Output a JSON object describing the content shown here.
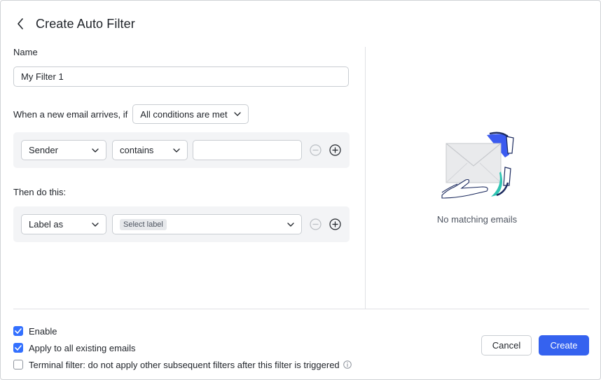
{
  "dialog": {
    "title": "Create Auto Filter"
  },
  "name_section": {
    "label": "Name",
    "value": "My Filter 1"
  },
  "conditions": {
    "prefix": "When a new email arrives, if",
    "match_mode": "All conditions are met",
    "rule": {
      "field": "Sender",
      "operator": "contains",
      "value": ""
    }
  },
  "actions": {
    "label": "Then do this:",
    "rule": {
      "action": "Label as",
      "target_placeholder": "Select label"
    }
  },
  "preview": {
    "empty_text": "No matching emails"
  },
  "options": [
    {
      "label": "Enable",
      "checked": true
    },
    {
      "label": "Apply to all existing emails",
      "checked": true
    },
    {
      "label": "Terminal filter: do not apply other subsequent filters after this filter is triggered",
      "checked": false
    }
  ],
  "footer": {
    "cancel_label": "Cancel",
    "create_label": "Create"
  },
  "colors": {
    "primary": "#3562ef",
    "checkbox": "#3370ff",
    "illustration_blue": "#3b5bf0",
    "illustration_teal": "#2fc4b2"
  }
}
